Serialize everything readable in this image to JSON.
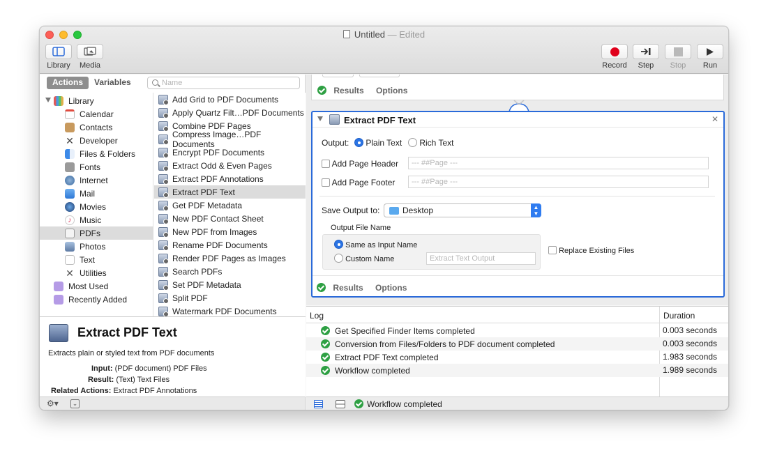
{
  "window": {
    "title": "Untitled",
    "edited_suffix": "— Edited"
  },
  "toolbar": {
    "left": [
      {
        "label": "Library",
        "icon": "library-icon"
      },
      {
        "label": "Media",
        "icon": "media-icon"
      }
    ],
    "right": [
      {
        "label": "Record",
        "icon": "record-icon"
      },
      {
        "label": "Step",
        "icon": "step-icon"
      },
      {
        "label": "Stop",
        "icon": "stop-icon"
      },
      {
        "label": "Run",
        "icon": "run-icon"
      }
    ]
  },
  "sidebar": {
    "tabs": [
      "Actions",
      "Variables"
    ],
    "search_placeholder": "Name",
    "library_label": "Library",
    "categories": [
      "Calendar",
      "Contacts",
      "Developer",
      "Files & Folders",
      "Fonts",
      "Internet",
      "Mail",
      "Movies",
      "Music",
      "PDFs",
      "Photos",
      "Text",
      "Utilities"
    ],
    "selected_category": "PDFs",
    "smart_groups": [
      "Most Used",
      "Recently Added"
    ]
  },
  "actions": [
    "Add Grid to PDF Documents",
    "Apply Quartz Filt…PDF Documents",
    "Combine PDF Pages",
    "Compress Image…PDF Documents",
    "Encrypt PDF Documents",
    "Extract Odd & Even Pages",
    "Extract PDF Annotations",
    "Extract PDF Text",
    "Get PDF Metadata",
    "New PDF Contact Sheet",
    "New PDF from Images",
    "Rename PDF Documents",
    "Render PDF Pages as Images",
    "Search PDFs",
    "Set PDF Metadata",
    "Split PDF",
    "Watermark PDF Documents"
  ],
  "selected_action": "Extract PDF Text",
  "description": {
    "title": "Extract PDF Text",
    "summary": "Extracts plain or styled text from PDF documents",
    "input_label": "Input:",
    "input_value": "(PDF document) PDF Files",
    "result_label": "Result:",
    "result_value": "(Text) Text Files",
    "related_label": "Related Actions:",
    "related_value": "Extract PDF Annotations"
  },
  "prev_card": {
    "results_tab": "Results",
    "options_tab": "Options"
  },
  "card": {
    "title": "Extract PDF Text",
    "output_label": "Output:",
    "plain_text": "Plain Text",
    "rich_text": "Rich Text",
    "page_header_label": "Add Page Header",
    "page_header_value": "--- ##Page ---",
    "page_footer_label": "Add Page Footer",
    "page_footer_value": "--- ##Page ---",
    "save_output_label": "Save Output to:",
    "save_output_value": "Desktop",
    "file_name_label": "Output File Name",
    "same_as_input": "Same as Input Name",
    "custom_name": "Custom Name",
    "custom_name_placeholder": "Extract Text Output",
    "replace_existing": "Replace Existing Files",
    "results_tab": "Results",
    "options_tab": "Options"
  },
  "log": {
    "col_log": "Log",
    "col_duration": "Duration",
    "rows": [
      {
        "text": "Get Specified Finder Items completed",
        "duration": "0.003 seconds"
      },
      {
        "text": "Conversion from Files/Folders to PDF document completed",
        "duration": "0.003 seconds"
      },
      {
        "text": "Extract PDF Text completed",
        "duration": "1.983 seconds"
      },
      {
        "text": "Workflow completed",
        "duration": "1.989 seconds"
      }
    ]
  },
  "status": {
    "text": "Workflow completed"
  },
  "colors": {
    "accent": "#2a6ad9",
    "success": "#2ea043",
    "record": "#e0001b"
  }
}
